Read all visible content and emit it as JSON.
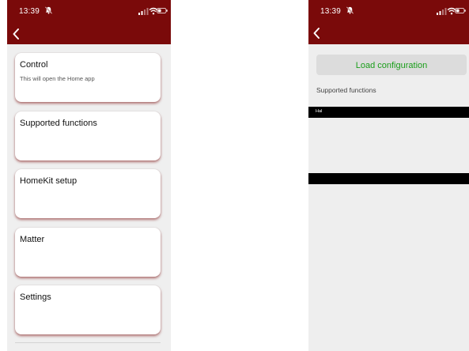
{
  "left_phone": {
    "status_bar": {
      "time": "13:39"
    },
    "cards": [
      {
        "title": "Control",
        "subtitle": "This will open the Home app"
      },
      {
        "title": "Supported functions",
        "subtitle": ""
      },
      {
        "title": "HomeKit setup",
        "subtitle": ""
      },
      {
        "title": "Matter",
        "subtitle": ""
      },
      {
        "title": "Settings",
        "subtitle": ""
      }
    ]
  },
  "right_phone": {
    "status_bar": {
      "time": "13:39"
    },
    "load_button_label": "Load configuration",
    "section_label": "Supported functions",
    "black_bar_text": "Hal"
  },
  "colors": {
    "header_red": "#7a0a0a",
    "load_button_text": "#1a9e1a"
  },
  "icons": [
    "back-chevron-icon",
    "silent-bell-icon",
    "cellular-signal-icon",
    "wifi-icon",
    "battery-icon"
  ]
}
